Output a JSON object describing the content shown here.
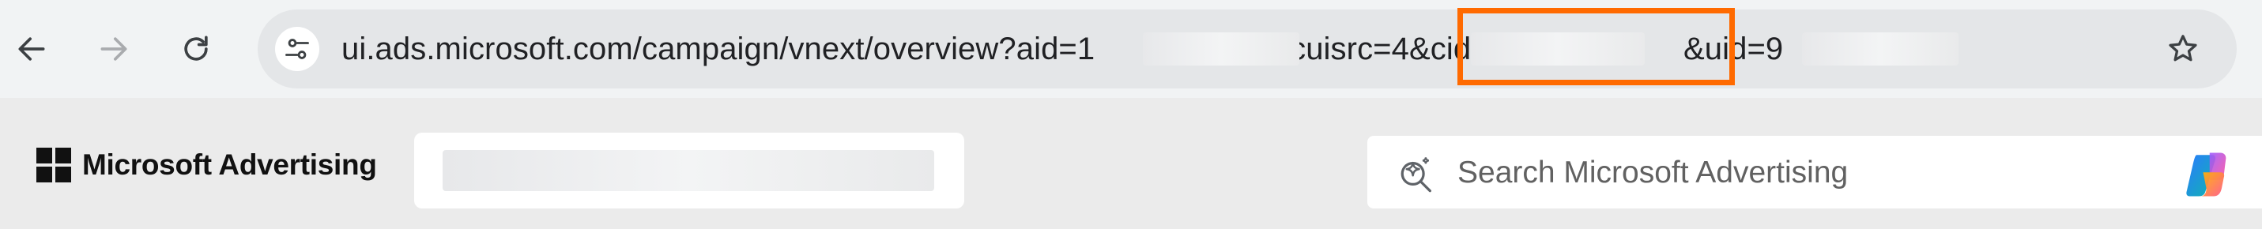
{
  "browser": {
    "back_icon": "arrow-left-icon",
    "forward_icon": "arrow-right-icon",
    "reload_icon": "reload-icon",
    "site_info_icon": "tune-icon",
    "bookmark_icon": "star-outline-icon",
    "url": {
      "seg1": "ui.ads.microsoft.com/campaign/vnext/overview?aid=1",
      "seg2": "&ccuisrc=4",
      "seg3": "&cid=2",
      "seg4": "&uid=9"
    },
    "highlight_color": "#ff6a00"
  },
  "app": {
    "brand_name": "Microsoft Advertising",
    "logo_icon": "microsoft-logo-icon",
    "search": {
      "placeholder": "Search Microsoft Advertising",
      "value": "",
      "icon": "sparkle-search-icon"
    },
    "copilot_icon": "copilot-icon"
  }
}
